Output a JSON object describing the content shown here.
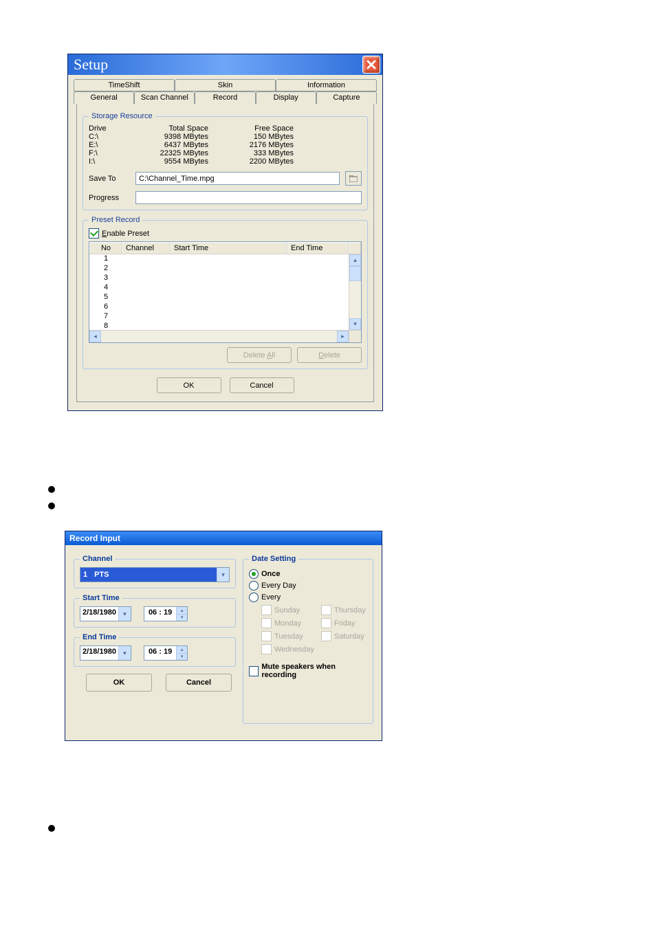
{
  "setup": {
    "title": "Setup",
    "tabs_back": [
      "TimeShift",
      "Skin",
      "Information"
    ],
    "tabs_front": [
      "General",
      "Scan Channel",
      "Record",
      "Display",
      "Capture"
    ],
    "storage_legend": "Storage Resource",
    "drive_cols": {
      "drive": "Drive",
      "total": "Total Space",
      "free": "Free Space"
    },
    "drives": [
      {
        "d": "C:\\",
        "t": "9398 MBytes",
        "f": "150 MBytes"
      },
      {
        "d": "E:\\",
        "t": "6437 MBytes",
        "f": "2176 MBytes"
      },
      {
        "d": "F:\\",
        "t": "22325 MBytes",
        "f": "333 MBytes"
      },
      {
        "d": "I:\\",
        "t": "9554 MBytes",
        "f": "2200 MBytes"
      }
    ],
    "saveto_label": "Save To",
    "saveto_value": "C:\\Channel_Time.mpg",
    "progress_label": "Progress",
    "preset_legend": "Preset Record",
    "enable_preset": "Enable Preset",
    "list_cols": {
      "no": "No",
      "ch": "Channel",
      "st": "Start Time",
      "et": "End Time"
    },
    "list_rows": [
      "1",
      "2",
      "3",
      "4",
      "5",
      "6",
      "7",
      "8"
    ],
    "delete_all": "Delete All",
    "delete": "Delete",
    "ok": "OK",
    "cancel": "Cancel"
  },
  "record": {
    "title": "Record Input",
    "channel_legend": "Channel",
    "channel_num": "1",
    "channel_name": "PTS",
    "start_legend": "Start Time",
    "start_date": "2/18/1980",
    "start_time": "06 : 19",
    "end_legend": "End Time",
    "end_date": "2/18/1980",
    "end_time": "06 : 19",
    "ok": "OK",
    "cancel": "Cancel",
    "date_legend": "Date Setting",
    "once": "Once",
    "everyday": "Every Day",
    "every": "Every",
    "days": {
      "sun": "Sunday",
      "mon": "Monday",
      "tue": "Tuesday",
      "wed": "Wednesday",
      "thu": "Thursday",
      "fri": "Friday",
      "sat": "Saturday"
    },
    "mute": "Mute speakers when recording"
  }
}
